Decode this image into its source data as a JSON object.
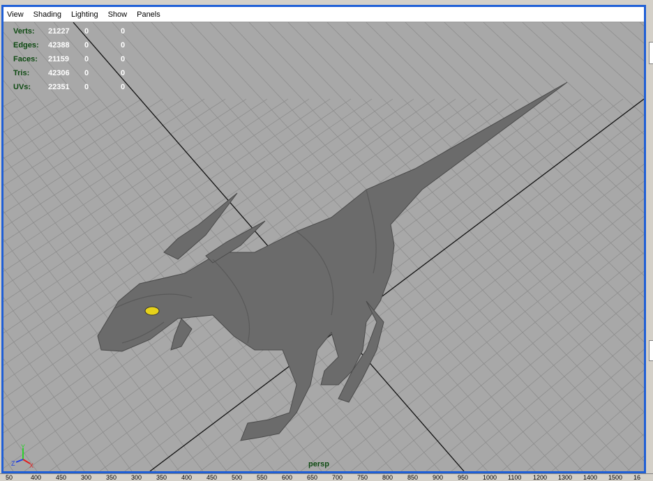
{
  "menu": [
    {
      "label": "View"
    },
    {
      "label": "Shading"
    },
    {
      "label": "Lighting"
    },
    {
      "label": "Show"
    },
    {
      "label": "Panels"
    }
  ],
  "hud": {
    "rows": [
      {
        "label": "Verts:",
        "value": "21227",
        "sel1": "0",
        "sel2": "0"
      },
      {
        "label": "Edges:",
        "value": "42388",
        "sel1": "0",
        "sel2": "0"
      },
      {
        "label": "Faces:",
        "value": "21159",
        "sel1": "0",
        "sel2": "0"
      },
      {
        "label": "Tris:",
        "value": "42306",
        "sel1": "0",
        "sel2": "0"
      },
      {
        "label": "UVs:",
        "value": "22351",
        "sel1": "0",
        "sel2": "0"
      }
    ]
  },
  "camera": {
    "name": "persp"
  },
  "axis": {
    "x": "X",
    "y": "Y",
    "z": "Z"
  },
  "colors": {
    "frame": "#1f5fd6",
    "viewport_bg": "#a8a8a8",
    "grid_line": "#8c8c8c",
    "model": "#6a6a6a",
    "eye": "#e6d21a"
  },
  "ruler": [
    "50",
    "400",
    "450",
    "300",
    "350",
    "300",
    "350",
    "400",
    "450",
    "500",
    "550",
    "600",
    "650",
    "700",
    "750",
    "800",
    "850",
    "900",
    "950",
    "1000",
    "1100",
    "1200",
    "1300",
    "1400",
    "1500",
    "16"
  ]
}
